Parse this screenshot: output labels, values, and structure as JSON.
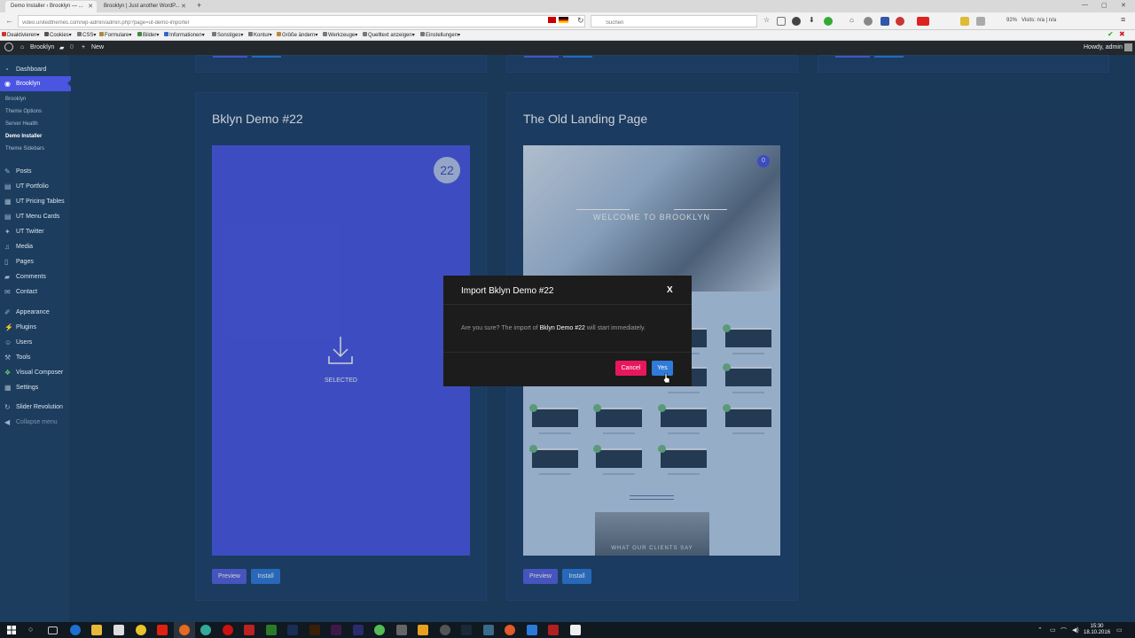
{
  "browser": {
    "tabs": [
      {
        "label": "Demo Installer ‹ Brooklyn — ..."
      },
      {
        "label": "Brooklyn | Just another WordP..."
      }
    ],
    "url": "video.unitedthemes.com/wp-admin/admin.php?page=ut-demo-importer",
    "search_placeholder": "Suchen",
    "zoom": "92%",
    "visits": "Visits: n/a | n/a",
    "bookmarks": [
      "Deaktivieren▾",
      "Cookies▾",
      "CSS▾",
      "Formulare▾",
      "Bilder▾",
      "Informationen▾",
      "Sonstiges▾",
      "Kontur▾",
      "Größe ändern▾",
      "Werkzeuge▾",
      "Quelltext anzeigen▾",
      "Einstellungen▾"
    ]
  },
  "adminbar": {
    "site_name": "Brooklyn",
    "comments_count": "0",
    "new_label": "New",
    "howdy": "Howdy, admin"
  },
  "sidebar": {
    "dashboard": "Dashboard",
    "brooklyn": "Brooklyn",
    "submenu": [
      "Brooklyn",
      "Theme Options",
      "Server Health",
      "Demo Installer",
      "Theme Sidebars"
    ],
    "items": [
      "Posts",
      "UT Portfolio",
      "UT Pricing Tables",
      "UT Menu Cards",
      "UT Twitter",
      "Media",
      "Pages",
      "Comments",
      "Contact"
    ],
    "items2": [
      "Appearance",
      "Plugins",
      "Users",
      "Tools",
      "Visual Composer",
      "Settings"
    ],
    "slider": "Slider Revolution",
    "collapse": "Collapse menu"
  },
  "demos": [
    {
      "title": "Bklyn Demo #22",
      "badge": "22",
      "status": "SELECTED",
      "preview": "Preview",
      "install": "Install"
    },
    {
      "title": "The Old Landing Page",
      "badge": "0",
      "hero_text": "WELCOME TO BROOKLYN",
      "clients_text": "WHAT OUR CLIENTS SAY",
      "preview": "Preview",
      "install": "Install"
    }
  ],
  "modal": {
    "title": "Import Bklyn Demo #22",
    "close": "X",
    "body_pre": "Are you sure? The import of",
    "body_name": "Bklyn Demo #22",
    "body_post": "will start immediately.",
    "cancel": "Cancel",
    "yes": "Yes"
  },
  "taskbar": {
    "time": "15:30",
    "date": "18.10.2016"
  },
  "colors": {
    "accent": "#4a58e4",
    "background": "#1d3d5e",
    "cancel": "#e8175d",
    "install": "#2e7bd9"
  }
}
